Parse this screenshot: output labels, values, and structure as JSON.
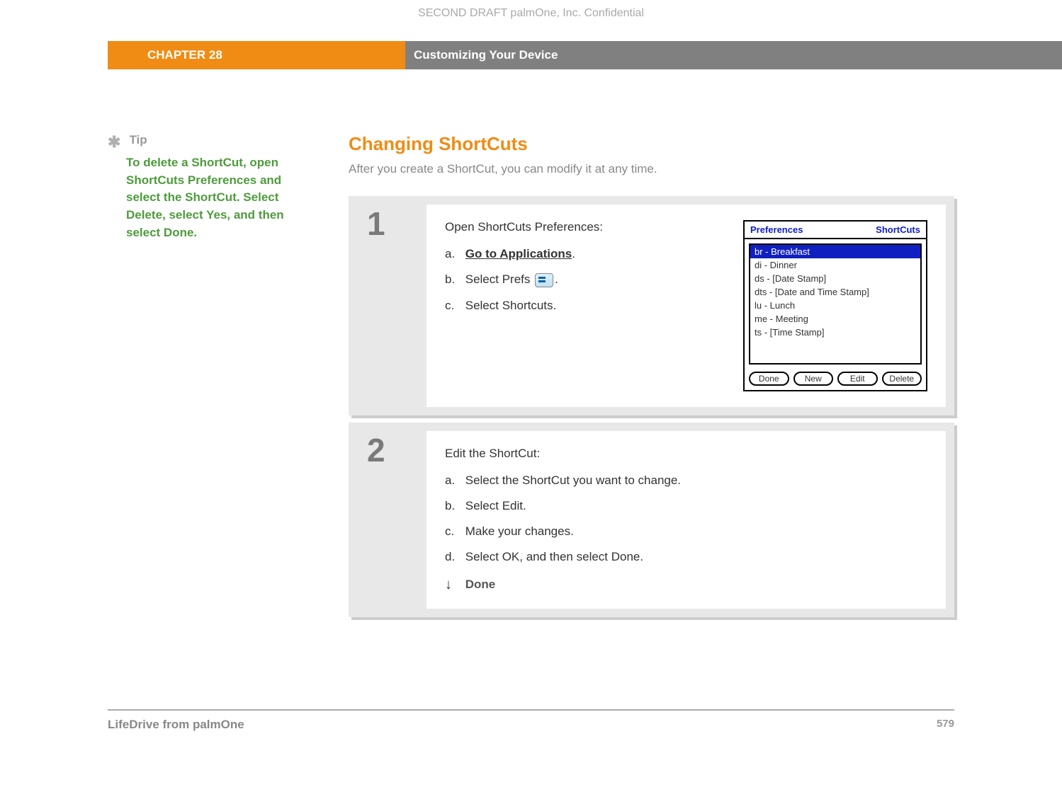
{
  "header": {
    "confidential": "SECOND DRAFT palmOne, Inc.  Confidential",
    "chapter": "CHAPTER 28",
    "title": "Customizing Your Device"
  },
  "sidebar": {
    "tip_label": "Tip",
    "tip_body": "To delete a ShortCut, open ShortCuts Preferences and select the ShortCut. Select Delete, select Yes, and then select Done."
  },
  "main": {
    "heading": "Changing ShortCuts",
    "intro": "After you create a ShortCut, you can modify it at any time."
  },
  "steps": [
    {
      "num": "1",
      "lead": "Open ShortCuts Preferences:",
      "items": [
        {
          "let": "a.",
          "pre": "",
          "link": "Go to Applications",
          "post": "."
        },
        {
          "let": "b.",
          "pre": "Select Prefs ",
          "icon": true,
          "post": "."
        },
        {
          "let": "c.",
          "pre": "Select Shortcuts.",
          "post": ""
        }
      ]
    },
    {
      "num": "2",
      "lead": "Edit the ShortCut:",
      "items": [
        {
          "let": "a.",
          "pre": "Select the ShortCut you want to change.",
          "post": ""
        },
        {
          "let": "b.",
          "pre": "Select Edit.",
          "post": ""
        },
        {
          "let": "c.",
          "pre": "Make your changes.",
          "post": ""
        },
        {
          "let": "d.",
          "pre": "Select OK, and then select Done.",
          "post": ""
        }
      ],
      "done": "Done"
    }
  ],
  "palm": {
    "title_left": "Preferences",
    "title_right": "ShortCuts",
    "items": [
      "br - Breakfast",
      "di - Dinner",
      "ds - [Date Stamp]",
      "dts - [Date and Time Stamp]",
      "lu - Lunch",
      "me - Meeting",
      "ts - [Time Stamp]"
    ],
    "buttons": [
      "Done",
      "New",
      "Edit",
      "Delete"
    ]
  },
  "footer": {
    "product": "LifeDrive from palmOne",
    "page": "579"
  }
}
